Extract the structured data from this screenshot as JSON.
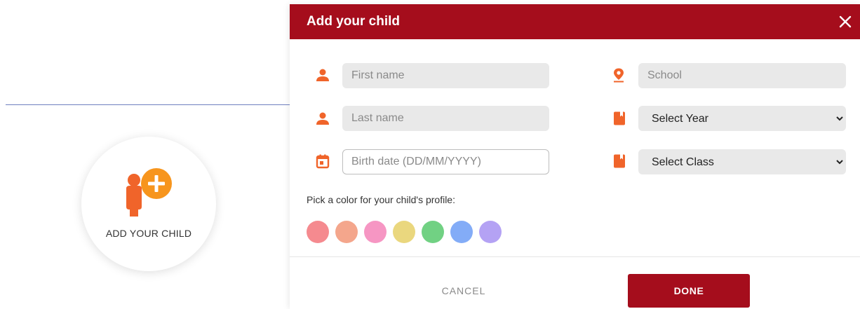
{
  "background": {
    "add_child_card": {
      "label": "ADD YOUR CHILD",
      "icon": "add-child-icon"
    }
  },
  "modal": {
    "title": "Add your child",
    "close_icon": "close-icon",
    "fields": {
      "first_name": {
        "placeholder": "First name",
        "value": "",
        "icon": "person-icon"
      },
      "last_name": {
        "placeholder": "Last name",
        "value": "",
        "icon": "person-icon"
      },
      "birth_date": {
        "placeholder": "Birth date (DD/MM/YYYY)",
        "value": "",
        "icon": "calendar-icon"
      },
      "school": {
        "placeholder": "School",
        "value": "",
        "icon": "location-pin-icon"
      },
      "year": {
        "selected": "Select Year",
        "icon": "book-icon"
      },
      "class": {
        "selected": "Select Class",
        "icon": "book-icon"
      }
    },
    "color_picker": {
      "label": "Pick a color for your child's profile:",
      "colors": [
        "#f58a8f",
        "#f4a68c",
        "#f696c3",
        "#ead77e",
        "#71d183",
        "#83acf7",
        "#b4a2f4"
      ]
    },
    "footer": {
      "cancel_label": "CANCEL",
      "done_label": "DONE"
    }
  },
  "colors": {
    "brand": "#a50d1c",
    "accent": "#f0642a",
    "accent_light": "#f7951d"
  }
}
